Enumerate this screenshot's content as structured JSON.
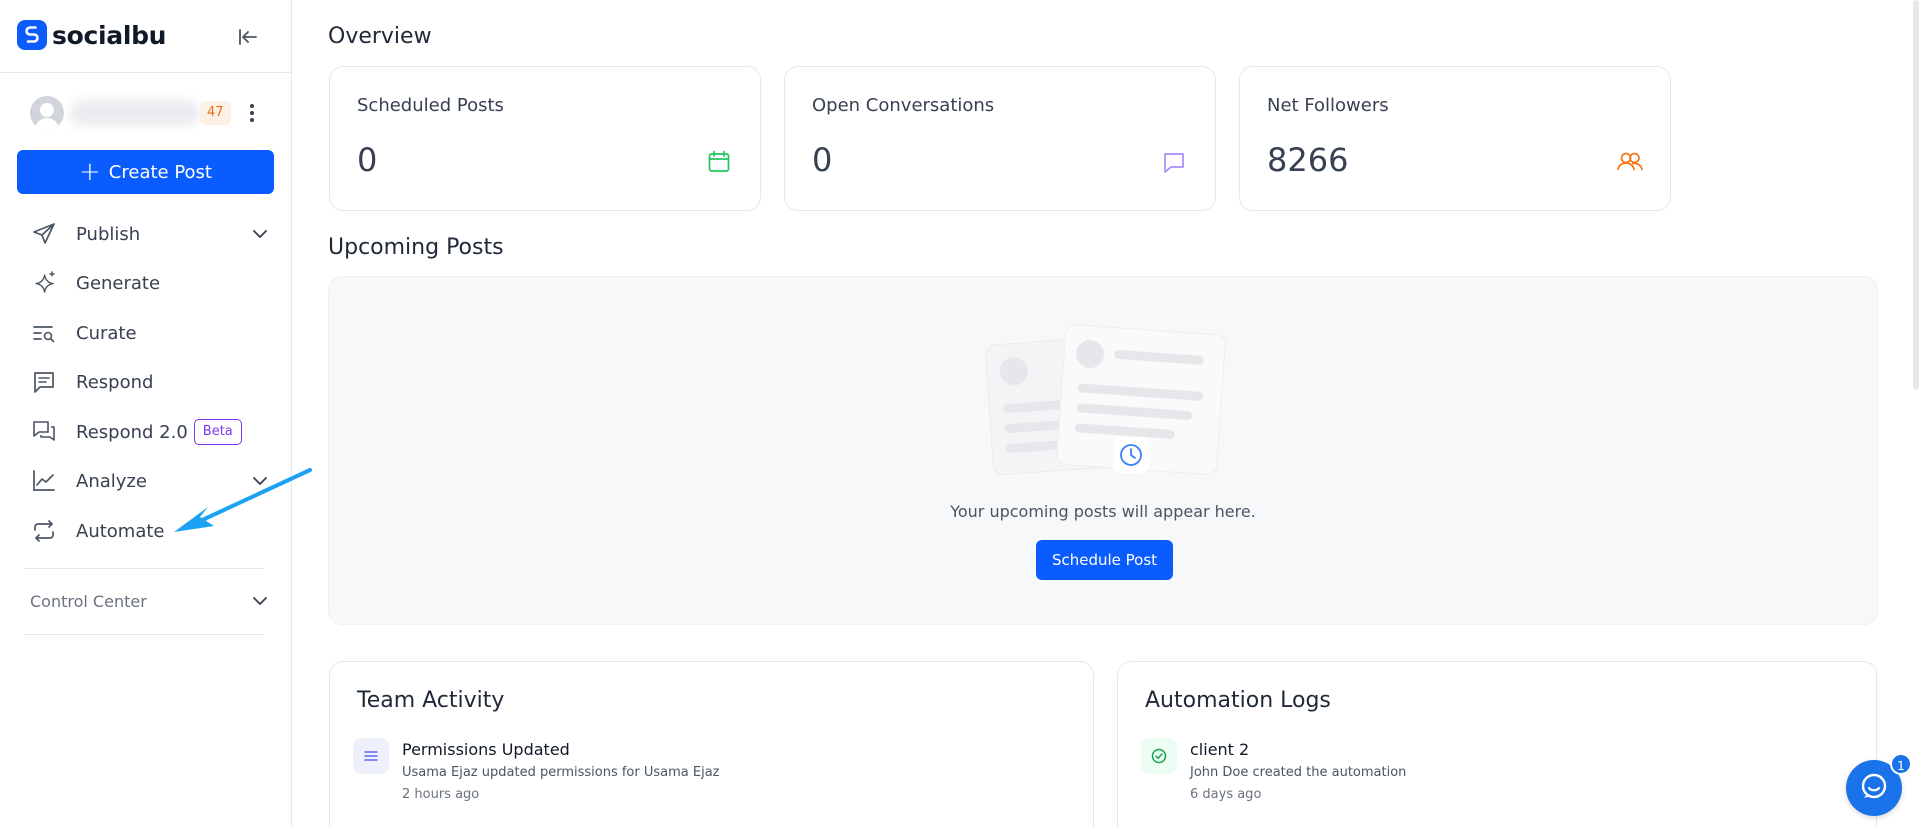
{
  "brand": {
    "name": "socialbu"
  },
  "account": {
    "notification_count": "47"
  },
  "sidebar": {
    "create_post_label": "Create Post",
    "items": [
      {
        "label": "Publish",
        "icon": "send-icon",
        "has_chevron": true
      },
      {
        "label": "Generate",
        "icon": "sparkles-icon",
        "has_chevron": false
      },
      {
        "label": "Curate",
        "icon": "curate-search-icon",
        "has_chevron": false
      },
      {
        "label": "Respond",
        "icon": "message-icon",
        "has_chevron": false
      },
      {
        "label": "Respond 2.0",
        "icon": "messages-icon",
        "badge": "Beta",
        "has_chevron": false
      },
      {
        "label": "Analyze",
        "icon": "chart-line-icon",
        "has_chevron": true
      },
      {
        "label": "Automate",
        "icon": "repeat-icon",
        "has_chevron": false
      }
    ],
    "control_center": "Control Center"
  },
  "overview": {
    "title": "Overview",
    "cards": [
      {
        "label": "Scheduled Posts",
        "value": "0",
        "icon": "calendar-icon",
        "icon_color": "#22c55e"
      },
      {
        "label": "Open Conversations",
        "value": "0",
        "icon": "chat-bubble-icon",
        "icon_color": "#a78bfa"
      },
      {
        "label": "Net Followers",
        "value": "8266",
        "icon": "users-icon",
        "icon_color": "#f97316"
      }
    ]
  },
  "upcoming": {
    "title": "Upcoming Posts",
    "empty_text": "Your upcoming posts will appear here.",
    "button_label": "Schedule Post"
  },
  "team_activity": {
    "title": "Team Activity",
    "item": {
      "title": "Permissions Updated",
      "description": "Usama Ejaz updated permissions for Usama Ejaz",
      "time": "2 hours ago"
    }
  },
  "automation_logs": {
    "title": "Automation Logs",
    "item": {
      "title": "client 2",
      "description": "John Doe created the automation",
      "time": "6 days ago"
    }
  },
  "chat": {
    "badge": "1"
  },
  "colors": {
    "primary": "#0b5cff",
    "annotation_arrow": "#1da1f2"
  }
}
